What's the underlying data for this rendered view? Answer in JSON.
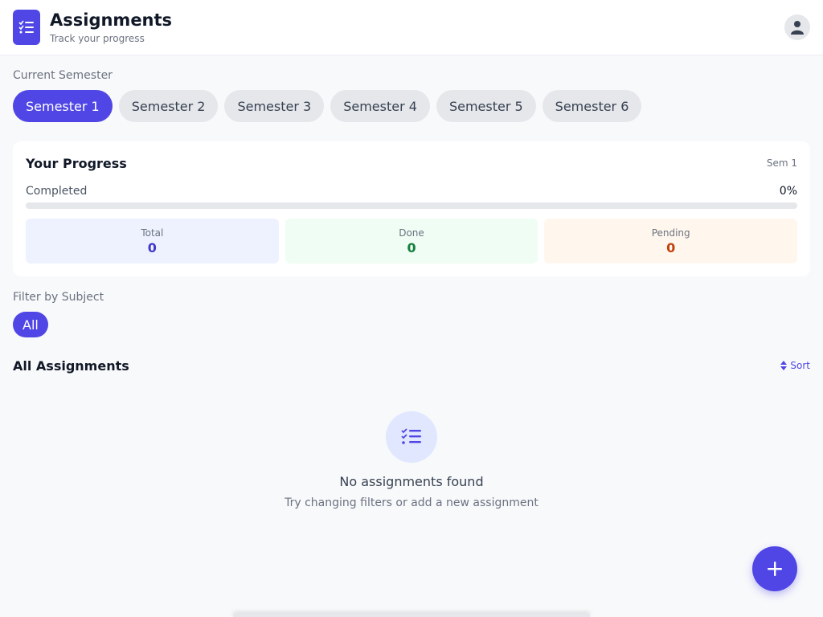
{
  "header": {
    "title": "Assignments",
    "subtitle": "Track your progress",
    "logo_icon": "checklist-icon",
    "avatar_icon": "user-icon"
  },
  "semesters": {
    "label": "Current Semester",
    "items": [
      {
        "label": "Semester 1",
        "active": true
      },
      {
        "label": "Semester 2",
        "active": false
      },
      {
        "label": "Semester 3",
        "active": false
      },
      {
        "label": "Semester 4",
        "active": false
      },
      {
        "label": "Semester 5",
        "active": false
      },
      {
        "label": "Semester 6",
        "active": false
      }
    ]
  },
  "progress": {
    "title": "Your Progress",
    "semester_badge": "Sem 1",
    "completed_label": "Completed",
    "completed_percent": "0%",
    "completed_fraction": 0,
    "stats": {
      "total_label": "Total",
      "total_value": "0",
      "done_label": "Done",
      "done_value": "0",
      "pending_label": "Pending",
      "pending_value": "0"
    }
  },
  "filter": {
    "label": "Filter by Subject",
    "selected": "All"
  },
  "list": {
    "title": "All Assignments",
    "sort_label": "Sort",
    "sort_icon": "sort-icon"
  },
  "empty_state": {
    "icon": "checklist-icon",
    "title": "No assignments found",
    "subtitle": "Try changing filters or add a new assignment"
  },
  "fab": {
    "label": "+",
    "icon": "plus-icon"
  },
  "colors": {
    "accent": "#4f46e5",
    "background": "#f8f9fb",
    "total": "#4338ca",
    "done": "#15803d",
    "pending": "#c2410c"
  }
}
